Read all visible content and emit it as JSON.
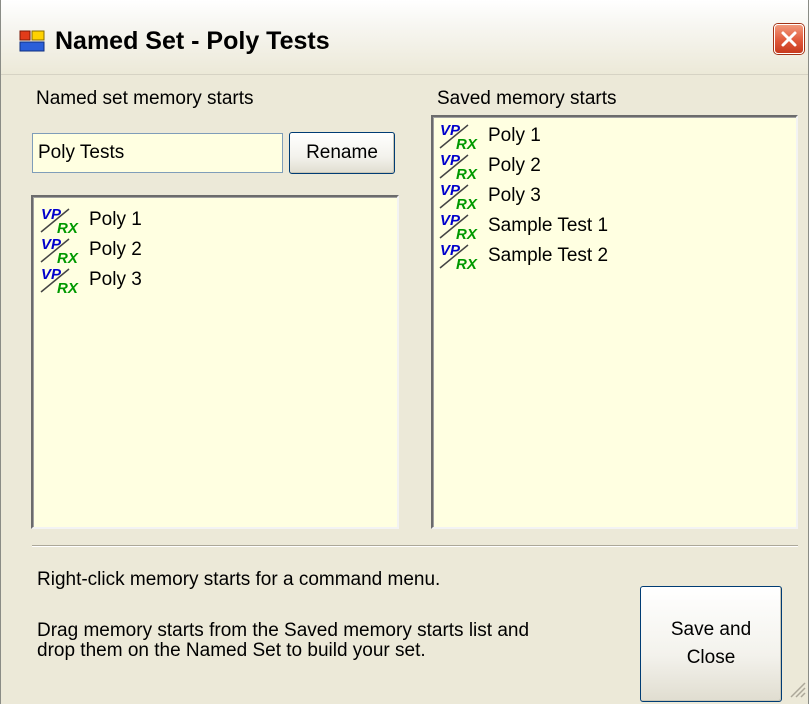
{
  "window": {
    "title": "Named Set - Poly Tests"
  },
  "named_set": {
    "label": "Named set memory starts",
    "name_value": "Poly Tests",
    "rename_label": "Rename",
    "items": [
      {
        "icon": "vprx-icon",
        "label": "Poly 1"
      },
      {
        "icon": "vprx-icon",
        "label": "Poly 2"
      },
      {
        "icon": "vprx-icon",
        "label": "Poly 3"
      }
    ]
  },
  "saved": {
    "label": "Saved memory starts",
    "items": [
      {
        "icon": "vprx-icon",
        "label": "Poly 1"
      },
      {
        "icon": "vprx-icon",
        "label": "Poly 2"
      },
      {
        "icon": "vprx-icon",
        "label": "Poly 3"
      },
      {
        "icon": "vprx-icon",
        "label": "Sample Test 1"
      },
      {
        "icon": "vprx-icon",
        "label": "Sample Test 2"
      }
    ]
  },
  "help": {
    "line1": "Right-click memory starts for a command menu.",
    "line2": "Drag memory starts from the Saved memory starts list and",
    "line3": "drop them on the Named Set to build your set."
  },
  "save_close": {
    "line1": "Save and",
    "line2": "Close"
  },
  "colors": {
    "list_background": "#ffffe1",
    "dialog_background": "#ece9d8",
    "icon_blue": "#0000cc",
    "icon_green": "#009900"
  }
}
